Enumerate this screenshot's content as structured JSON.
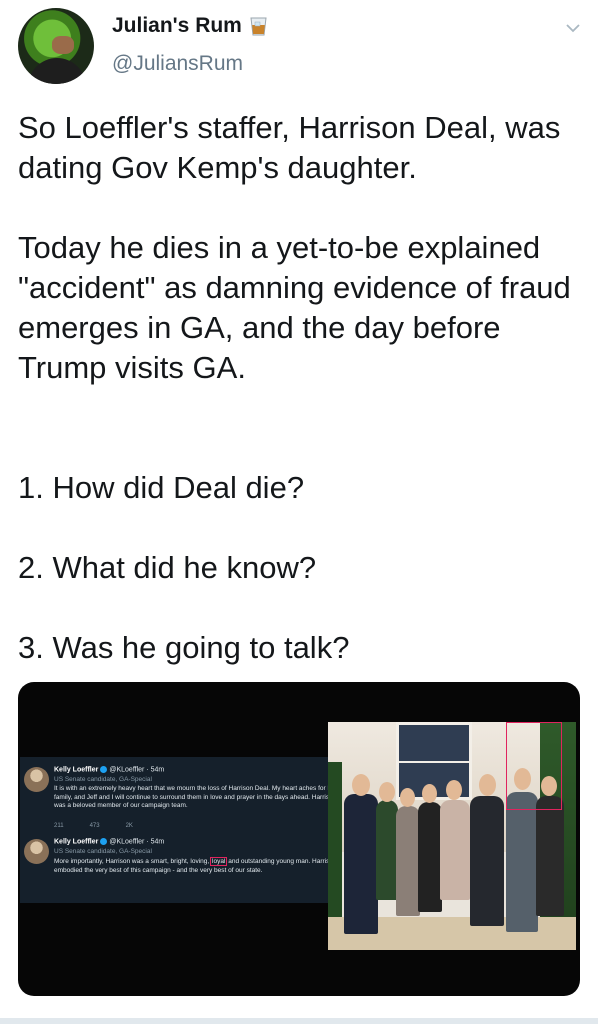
{
  "tweet": {
    "display_name": "Julian's Rum",
    "name_emoji_icon": "whiskey-glass-icon",
    "handle": "@JuliansRum",
    "para1": "So Loeffler's staffer, Harrison Deal, was dating Gov Kemp's daughter.",
    "para2": "Today he dies in a yet-to-be explained \"accident\" as damning evidence of fraud emerges in GA, and the day before Trump visits GA.",
    "list": [
      "1. How did Deal die?",
      "2. What did he know?",
      "3. Was he going to talk?"
    ]
  },
  "embedded_screenshot": {
    "tweets": [
      {
        "name": "Kelly Loeffler",
        "handle_time": "@KLoeffler · 54m",
        "subtitle": "US Senate candidate, GA-Special",
        "body": "It is with an extremely heavy heart that we mourn the loss of Harrison Deal. My heart aches for his family, and Jeff and I will continue to surround them in love and prayer in the days ahead. Harrison was a beloved member of our campaign team.",
        "replies": "211",
        "retweets": "473",
        "likes": "2K"
      },
      {
        "name": "Kelly Loeffler",
        "handle_time": "@KLoeffler · 54m",
        "subtitle": "US Senate candidate, GA-Special",
        "body_before": "More importantly, Harrison was a smart, bright, loving,",
        "body_highlight": "loyal",
        "body_after": "and outstanding young man. Harrison embodied the very best of this campaign - and the very best of our state."
      }
    ],
    "highlight_color": "#e0245e"
  },
  "colors": {
    "text": "#14171a",
    "secondary": "#657786",
    "dark_bg": "#15202b",
    "accent": "#1da1f2"
  }
}
